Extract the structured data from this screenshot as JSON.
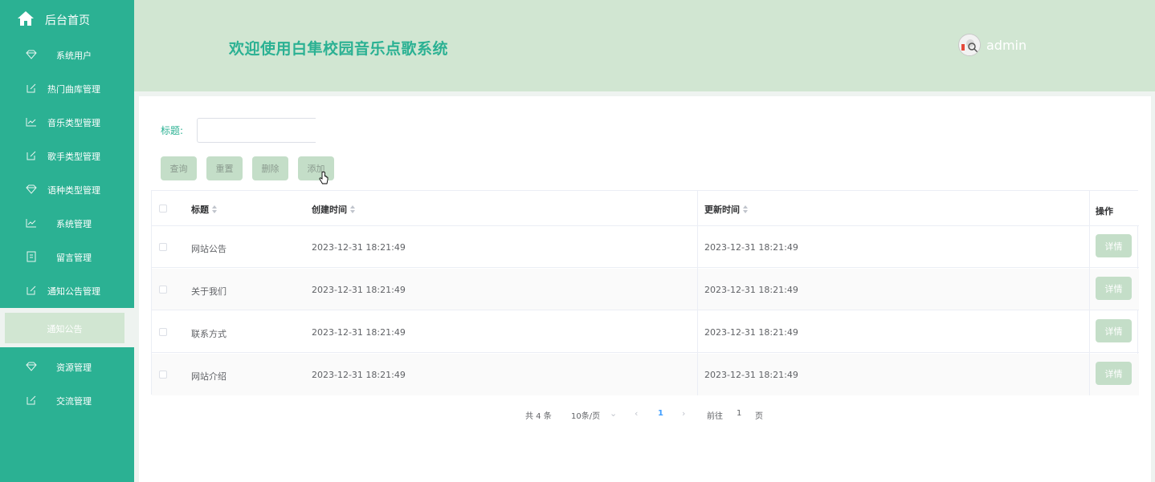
{
  "sidebar": {
    "home_label": "后台首页",
    "items": [
      {
        "label": "系统用户",
        "icon": "diamond-icon"
      },
      {
        "label": "热门曲库管理",
        "icon": "edit-icon"
      },
      {
        "label": "音乐类型管理",
        "icon": "chart-icon"
      },
      {
        "label": "歌手类型管理",
        "icon": "edit-icon"
      },
      {
        "label": "语种类型管理",
        "icon": "diamond-icon"
      },
      {
        "label": "系统管理",
        "icon": "chart-icon"
      },
      {
        "label": "留言管理",
        "icon": "message-icon"
      },
      {
        "label": "通知公告管理",
        "icon": "edit-icon"
      },
      {
        "label": "资源管理",
        "icon": "diamond-icon"
      },
      {
        "label": "交流管理",
        "icon": "edit-icon"
      }
    ],
    "active_sub": "通知公告"
  },
  "header": {
    "title": "欢迎使用白隼校园音乐点歌系统",
    "username": "admin"
  },
  "search": {
    "label": "标题:",
    "placeholder": ""
  },
  "toolbar": {
    "query": "查询",
    "reset": "重置",
    "delete": "删除",
    "add": "添加"
  },
  "table": {
    "columns": [
      "标题",
      "创建时间",
      "更新时间",
      "操作"
    ],
    "rows": [
      {
        "title": "网站公告",
        "created": "2023-12-31 18:21:49",
        "updated": "2023-12-31 18:21:49",
        "action": "详情"
      },
      {
        "title": "关于我们",
        "created": "2023-12-31 18:21:49",
        "updated": "2023-12-31 18:21:49",
        "action": "详情"
      },
      {
        "title": "联系方式",
        "created": "2023-12-31 18:21:49",
        "updated": "2023-12-31 18:21:49",
        "action": "详情"
      },
      {
        "title": "网站介绍",
        "created": "2023-12-31 18:21:49",
        "updated": "2023-12-31 18:21:49",
        "action": "详情"
      }
    ]
  },
  "pagination": {
    "total": "共 4 条",
    "page_size": "10条/页",
    "current": "1",
    "goto_label": "前往",
    "goto_value": "1",
    "page_suffix": "页"
  },
  "colors": {
    "sidebar": "#2bb193",
    "header": "#d1e6d2",
    "button": "#c4dec8"
  }
}
